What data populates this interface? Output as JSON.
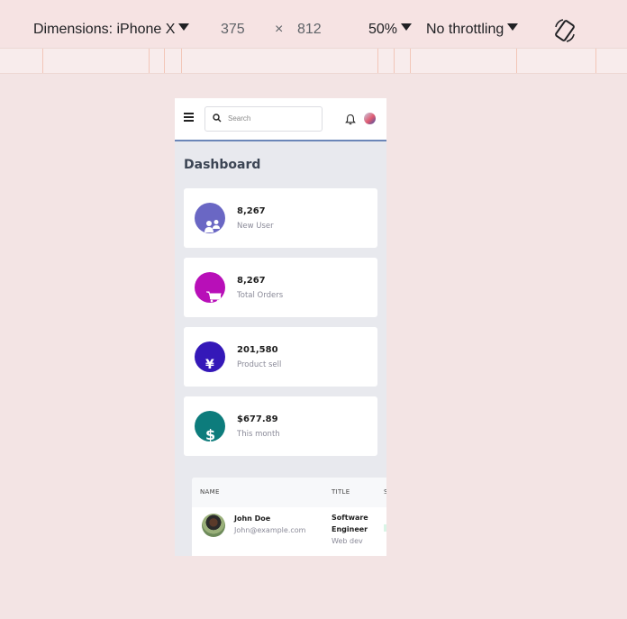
{
  "devtools": {
    "device_label": "Dimensions: iPhone X",
    "width": "375",
    "times": "×",
    "height": "812",
    "zoom": "50%",
    "throttle": "No throttling",
    "rotate_icon": "rotate-icon"
  },
  "topnav": {
    "menu_icon": "hamburger-icon",
    "search_placeholder": "Search",
    "search_icon": "search-icon",
    "bell_icon": "bell-icon"
  },
  "page": {
    "title": "Dashboard"
  },
  "cards": [
    {
      "value": "8,267",
      "label": "New User",
      "color": "#6a67c4",
      "icon": "users-icon"
    },
    {
      "value": "8,267",
      "label": "Total Orders",
      "color": "#b80fb8",
      "icon": "cart-icon"
    },
    {
      "value": "201,580",
      "label": "Product sell",
      "color": "#3418b8",
      "icon": "yen-icon",
      "glyph": "¥"
    },
    {
      "value": "$677.89",
      "label": "This month",
      "color": "#0d7c7c",
      "icon": "dollar-icon",
      "glyph": "$"
    }
  ],
  "table": {
    "headers": [
      "NAME",
      "TITLE",
      "S"
    ],
    "rows": [
      {
        "name": "John Doe",
        "email": "John@example.com",
        "title_line1": "Software",
        "title_line2": "Engineer",
        "dept": "Web dev"
      }
    ]
  }
}
